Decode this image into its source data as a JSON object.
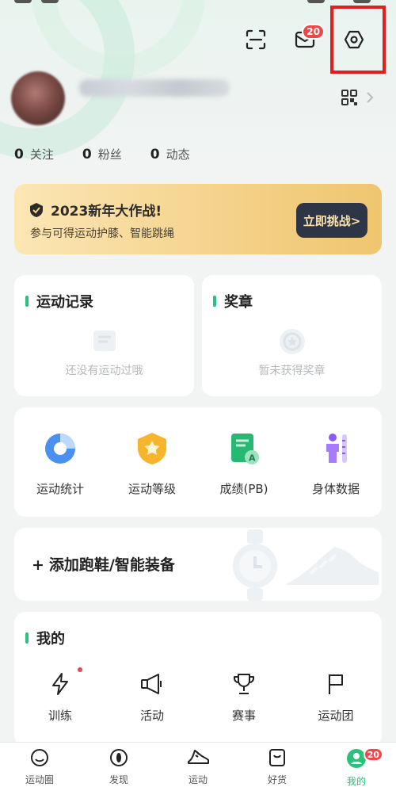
{
  "header": {
    "mail_badge": "20"
  },
  "stats": [
    {
      "num": "0",
      "label": "关注"
    },
    {
      "num": "0",
      "label": "粉丝"
    },
    {
      "num": "0",
      "label": "动态"
    }
  ],
  "banner": {
    "title": "2023新年大作战!",
    "subtitle": "参与可得运动护膝、智能跳绳",
    "cta": "立即挑战>"
  },
  "records": {
    "title": "运动记录",
    "empty": "还没有运动过哦"
  },
  "medals": {
    "title": "奖章",
    "empty": "暂未获得奖章"
  },
  "quick": [
    {
      "label": "运动统计",
      "icon": "pie-chart-icon"
    },
    {
      "label": "运动等级",
      "icon": "level-badge-icon"
    },
    {
      "label": "成绩(PB)",
      "icon": "pb-certificate-icon"
    },
    {
      "label": "身体数据",
      "icon": "body-data-icon"
    }
  ],
  "device": {
    "plus": "+",
    "label": "添加跑鞋/智能装备"
  },
  "mine": {
    "title": "我的",
    "items": [
      {
        "label": "训练",
        "icon": "lightning-icon"
      },
      {
        "label": "活动",
        "icon": "megaphone-icon"
      },
      {
        "label": "赛事",
        "icon": "trophy-icon"
      },
      {
        "label": "运动团",
        "icon": "flag-icon"
      }
    ]
  },
  "tabs": [
    {
      "label": "运动圈",
      "icon": "smile-icon"
    },
    {
      "label": "发现",
      "icon": "compass-icon"
    },
    {
      "label": "运动",
      "icon": "shoe-icon"
    },
    {
      "label": "好货",
      "icon": "shopping-bag-icon"
    },
    {
      "label": "我的",
      "icon": "profile-icon",
      "badge": "20"
    }
  ],
  "colors": {
    "accent": "#2ac17a",
    "badge": "#ef4747",
    "highlight": "#e02020",
    "banner_button": "#2d3547"
  }
}
